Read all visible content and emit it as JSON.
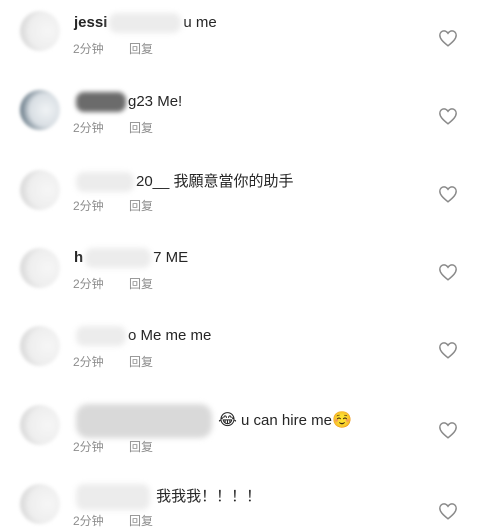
{
  "reply_label": "回复",
  "comments": [
    {
      "user_prefix": "jessi",
      "text": "u me",
      "time": "2分钟"
    },
    {
      "user_prefix": "",
      "text": "g23 Me!",
      "time": "2分钟"
    },
    {
      "user_prefix": "",
      "text": "20__ 我願意當你的助手",
      "time": "2分钟"
    },
    {
      "user_prefix": "h",
      "text": "7 ME",
      "time": "2分钟"
    },
    {
      "user_prefix": "",
      "text": "o Me me me",
      "time": "2分钟"
    },
    {
      "user_prefix": "",
      "text": "u can hire me",
      "emoji_before": "😂",
      "emoji_after": "☺️",
      "time": "2分钟"
    },
    {
      "user_prefix": "",
      "text": "我我我！！！！",
      "time": "2分钟"
    }
  ],
  "icons": {
    "like": "heart-outline-icon"
  },
  "colors": {
    "meta_text": "#8e8e8e",
    "body_text": "#262626",
    "background": "#ffffff"
  }
}
